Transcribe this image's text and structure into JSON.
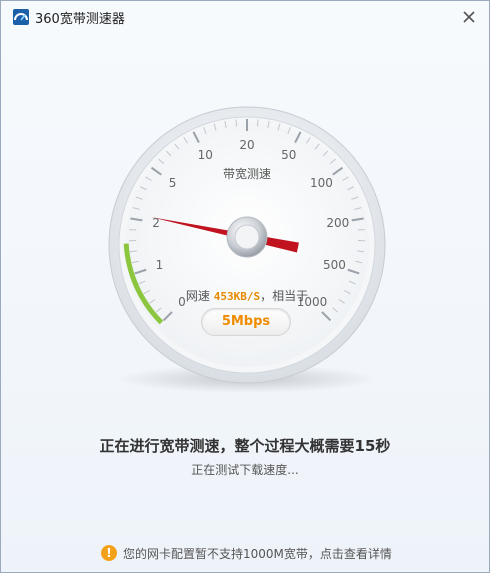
{
  "window": {
    "title": "360宽带测速器",
    "app_icon": "360-speedtest-logo-icon",
    "close_icon": "close-icon"
  },
  "gauge": {
    "label": "带宽测速",
    "ticks": [
      "0",
      "1",
      "2",
      "5",
      "10",
      "20",
      "50",
      "100",
      "200",
      "500",
      "1000"
    ],
    "speed_prefix": "网速",
    "speed_value": "453KB/S",
    "speed_suffix": "，相当于",
    "equivalent": "5Mbps",
    "needle_value_mbps": 5,
    "accent_color": "#8cc63f",
    "needle_color": "#c1121f"
  },
  "status": {
    "main": "正在进行宽带测速，整个过程大概需要15秒",
    "sub": "正在测试下载速度..."
  },
  "notice": {
    "icon": "warning-icon",
    "text": "您的网卡配置暂不支持1000M宽带，点击查看详情"
  }
}
